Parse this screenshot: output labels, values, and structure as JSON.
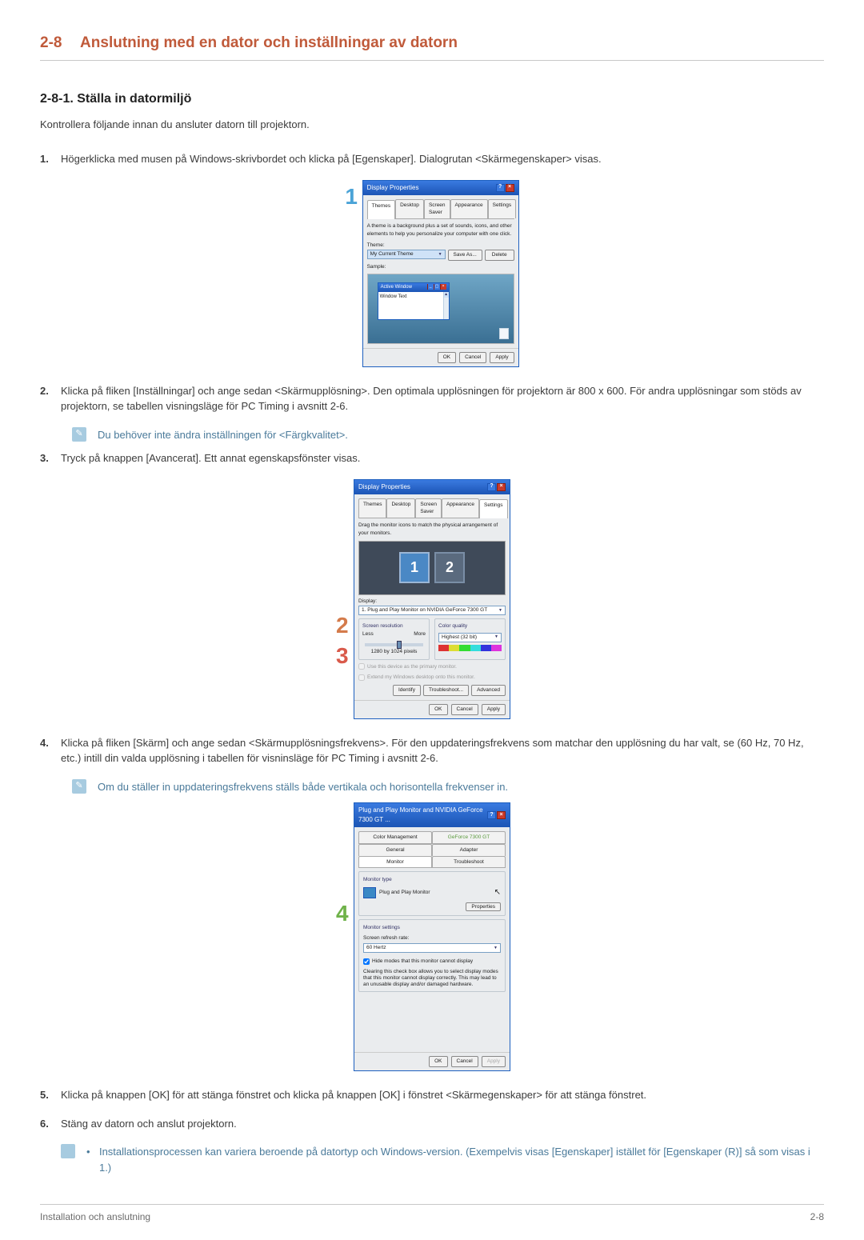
{
  "section": {
    "num": "2-8",
    "title": "Anslutning med en dator och inställningar av datorn"
  },
  "subsection": {
    "num": "2-8-1.",
    "title": "Ställa in datormiljö"
  },
  "intro": "Kontrollera följande innan du ansluter datorn till projektorn.",
  "steps": {
    "s1": {
      "n": "1.",
      "text": "Högerklicka med musen på Windows-skrivbordet och klicka på [Egenskaper]. Dialogrutan <Skärmegenskaper> visas."
    },
    "s2": {
      "n": "2.",
      "text": "Klicka på fliken [Inställningar] och ange sedan <Skärmupplösning>. Den optimala upplösningen för projektorn är 800 x 600. För andra upplösningar som stöds av projektorn, se tabellen visningsläge för PC Timing i avsnitt 2-6."
    },
    "s3": {
      "n": "3.",
      "text": "Tryck på knappen [Avancerat]. Ett annat egenskapsfönster visas."
    },
    "s4": {
      "n": "4.",
      "text": "Klicka på fliken [Skärm] och ange sedan <Skärmupplösningsfrekvens>. För den uppdateringsfrekvens som matchar den upplösning du har valt, se (60 Hz, 70 Hz, etc.) intill din valda upplösning i tabellen för visninsläge för PC Timing i avsnitt 2-6."
    },
    "s5": {
      "n": "5.",
      "text": "Klicka på knappen [OK] för att stänga fönstret och klicka på knappen [OK] i fönstret <Skärmegenskaper> för att stänga fönstret."
    },
    "s6": {
      "n": "6.",
      "text": "Stäng av datorn och anslut projektorn."
    }
  },
  "note1": "Du behöver inte ändra inställningen för <Färgkvalitet>.",
  "note2": "Om du ställer in uppdateringsfrekvens ställs både vertikala och horisontella frekvenser in.",
  "note3": "Installationsprocessen kan variera beroende på datortyp och Windows-version. (Exempelvis visas [Egenskaper] istället för [Egenskaper (R)] så som visas i 1.)",
  "callouts": {
    "c1": "1",
    "c2": "2",
    "c3": "3",
    "c4": "4"
  },
  "dlg1": {
    "title": "Display Properties",
    "tabs": [
      "Themes",
      "Desktop",
      "Screen Saver",
      "Appearance",
      "Settings"
    ],
    "desc": "A theme is a background plus a set of sounds, icons, and other elements to help you personalize your computer with one click.",
    "theme_lbl": "Theme:",
    "theme_sel": "My Current Theme",
    "saveas": "Save As...",
    "delete": "Delete",
    "sample_lbl": "Sample:",
    "aw_title": "Active Window",
    "aw_body": "Window Text",
    "ok": "OK",
    "cancel": "Cancel",
    "apply": "Apply"
  },
  "dlg2": {
    "title": "Display Properties",
    "tabs": [
      "Themes",
      "Desktop",
      "Screen Saver",
      "Appearance",
      "Settings"
    ],
    "desc": "Drag the monitor icons to match the physical arrangement of your monitors.",
    "mon1": "1",
    "mon2": "2",
    "display_lbl": "Display:",
    "display_sel": "1. Plug and Play Monitor on NVIDIA GeForce 7300 GT",
    "res_lbl": "Screen resolution",
    "less": "Less",
    "more": "More",
    "res_val": "1280 by 1024 pixels",
    "cq_lbl": "Color quality",
    "cq_val": "Highest (32 bit)",
    "chk1": "Use this device as the primary monitor.",
    "chk2": "Extend my Windows desktop onto this monitor.",
    "identify": "Identify",
    "trouble": "Troubleshoot...",
    "advanced": "Advanced",
    "ok": "OK",
    "cancel": "Cancel",
    "apply": "Apply"
  },
  "dlg3": {
    "title": "Plug and Play Monitor and NVIDIA GeForce 7300 GT ...",
    "tabs_row1": [
      "Color Management",
      "GeForce 7300 GT"
    ],
    "tabs_row2": [
      "General",
      "Adapter",
      "Monitor",
      "Troubleshoot"
    ],
    "mt_lbl": "Monitor type",
    "mt_name": "Plug and Play Monitor",
    "props": "Properties",
    "ms_lbl": "Monitor settings",
    "rr_lbl": "Screen refresh rate:",
    "rr_val": "60 Hertz",
    "hide_chk": "Hide modes that this monitor cannot display",
    "warn": "Clearing this check box allows you to select display modes that this monitor cannot display correctly. This may lead to an unusable display and/or damaged hardware.",
    "ok": "OK",
    "cancel": "Cancel",
    "apply": "Apply"
  },
  "footer": {
    "left": "Installation och anslutning",
    "right": "2-8"
  }
}
